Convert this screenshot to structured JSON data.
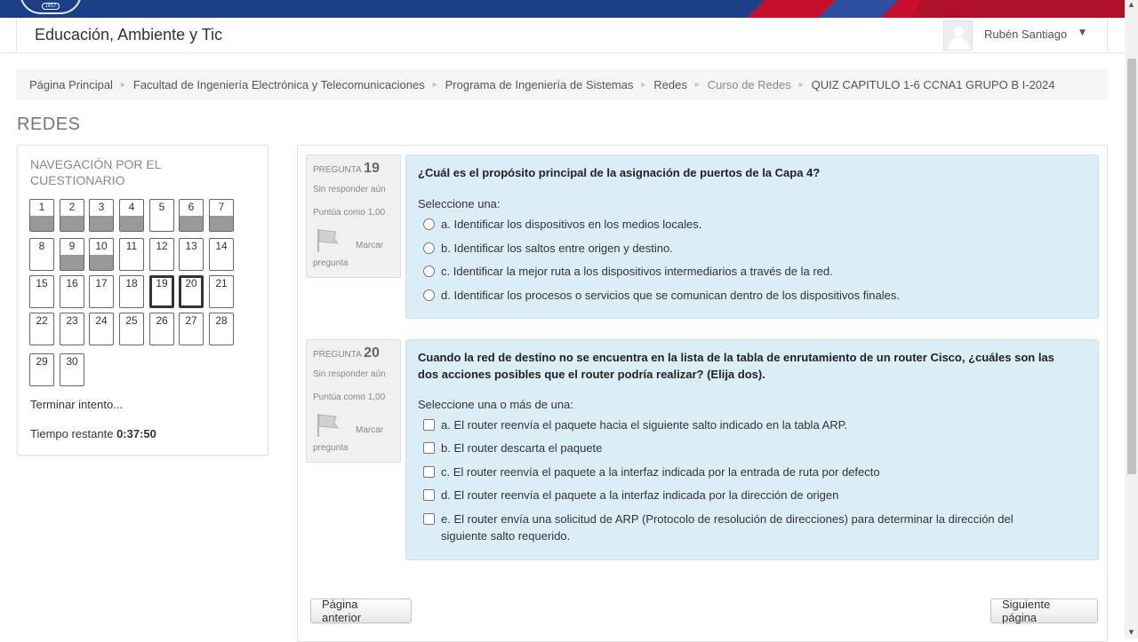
{
  "site": {
    "name": "Educación, Ambiente y Tic",
    "logo_text": "1857"
  },
  "user": {
    "name": "Rubén Santiago"
  },
  "breadcrumb": [
    "Página Principal",
    "Facultad de Ingeniería Electrónica y Telecomunicaciones",
    "Programa de Ingeniería de Sistemas",
    "Redes",
    "Curso de Redes",
    "QUIZ CAPITULO 1-6 CCNA1 GRUPO B I-2024"
  ],
  "page_title": "REDES",
  "quiz_nav": {
    "title": "NAVEGACIÓN POR EL CUESTIONARIO",
    "buttons": [
      {
        "label": "1",
        "answered": true,
        "current": false
      },
      {
        "label": "2",
        "answered": true,
        "current": false
      },
      {
        "label": "3",
        "answered": true,
        "current": false
      },
      {
        "label": "4",
        "answered": true,
        "current": false
      },
      {
        "label": "5",
        "answered": false,
        "current": false
      },
      {
        "label": "6",
        "answered": true,
        "current": false
      },
      {
        "label": "7",
        "answered": true,
        "current": false
      },
      {
        "label": "8",
        "answered": false,
        "current": false
      },
      {
        "label": "9",
        "answered": true,
        "current": false
      },
      {
        "label": "10",
        "answered": true,
        "current": false
      },
      {
        "label": "11",
        "answered": false,
        "current": false
      },
      {
        "label": "12",
        "answered": false,
        "current": false
      },
      {
        "label": "13",
        "answered": false,
        "current": false
      },
      {
        "label": "14",
        "answered": false,
        "current": false
      },
      {
        "label": "15",
        "answered": false,
        "current": false
      },
      {
        "label": "16",
        "answered": false,
        "current": false
      },
      {
        "label": "17",
        "answered": false,
        "current": false
      },
      {
        "label": "18",
        "answered": false,
        "current": false
      },
      {
        "label": "19",
        "answered": false,
        "current": true
      },
      {
        "label": "20",
        "answered": false,
        "current": true
      },
      {
        "label": "21",
        "answered": false,
        "current": false
      },
      {
        "label": "22",
        "answered": false,
        "current": false
      },
      {
        "label": "23",
        "answered": false,
        "current": false
      },
      {
        "label": "24",
        "answered": false,
        "current": false
      },
      {
        "label": "25",
        "answered": false,
        "current": false
      },
      {
        "label": "26",
        "answered": false,
        "current": false
      },
      {
        "label": "27",
        "answered": false,
        "current": false
      },
      {
        "label": "28",
        "answered": false,
        "current": false
      },
      {
        "label": "29",
        "answered": false,
        "current": false
      },
      {
        "label": "30",
        "answered": false,
        "current": false
      }
    ],
    "finish_label": "Terminar intento...",
    "time_label": "Tiempo restante",
    "time_value": "0:37:50"
  },
  "questions": [
    {
      "prefix": "PREGUNTA",
      "number": "19",
      "state": "Sin responder aún",
      "grade": "Puntúa como 1,00",
      "flag_label_1": "Marcar",
      "flag_label_2": "pregunta",
      "text": "¿Cuál es el propósito principal de la asignación de puertos de la Capa 4?",
      "prompt": "Seleccione una:",
      "type": "radio",
      "answers": [
        "a. Identificar los dispositivos en los medios locales.",
        "b. Identificar los saltos entre origen y destino.",
        "c. Identificar la mejor ruta a los dispositivos intermediarios a través de la red.",
        "d. Identificar los procesos o servicios que se comunican dentro de los dispositivos finales."
      ]
    },
    {
      "prefix": "PREGUNTA",
      "number": "20",
      "state": "Sin responder aún",
      "grade": "Puntúa como 1,00",
      "flag_label_1": "Marcar",
      "flag_label_2": "pregunta",
      "text": "Cuando la red de destino no se encuentra en la lista de la tabla de enrutamiento de un router Cisco, ¿cuáles son las dos acciones posibles que el router podría realizar? (Elija dos).",
      "prompt": "Seleccione una o más de una:",
      "type": "checkbox",
      "answers": [
        "a. El router reenvía el paquete hacia el siguiente salto indicado en la tabla ARP.",
        "b. El router descarta el paquete",
        "c. El router reenvía el paquete a la interfaz indicada por la entrada de ruta por defecto",
        "d. El router reenvía el paquete a la interfaz indicada por la dirección de origen",
        "e. El router envía una solicitud de ARP (Protocolo de resolución de direcciones) para determinar la dirección del siguiente salto requerido."
      ]
    }
  ],
  "buttons": {
    "prev": "Página anterior",
    "next": "Siguiente página"
  }
}
